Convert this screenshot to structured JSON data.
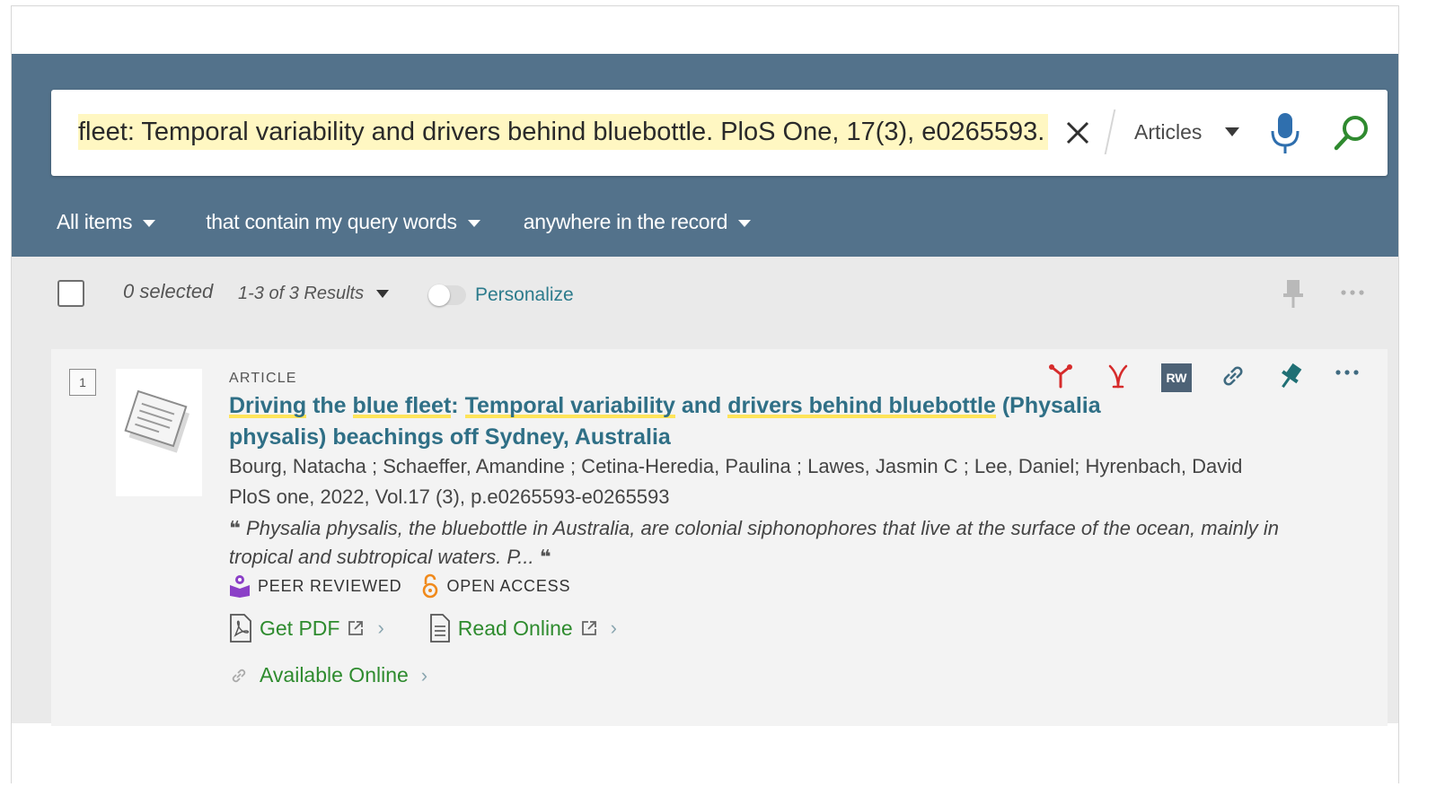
{
  "search": {
    "query_visible": "fleet: Temporal variability and drivers behind bluebottle. PloS One, 17(3), e0265593.",
    "scope": "Articles"
  },
  "filters": {
    "items": "All items",
    "match": "that contain my query words",
    "field": "anywhere in the record"
  },
  "results_bar": {
    "selected": "0 selected",
    "count": "1-3 of 3 Results",
    "personalize": "Personalize"
  },
  "result": {
    "index": "1",
    "type": "ARTICLE",
    "title_parts": [
      {
        "text": "Driving",
        "hl": true
      },
      {
        "text": " the ",
        "hl": false
      },
      {
        "text": "blue fleet",
        "hl": true
      },
      {
        "text": ": ",
        "hl": false
      },
      {
        "text": "Temporal variability",
        "hl": true
      },
      {
        "text": " and ",
        "hl": false
      },
      {
        "text": "drivers behind bluebottle",
        "hl": true
      },
      {
        "text": " (Physalia physalis) beachings off Sydney, Australia",
        "hl": false
      }
    ],
    "authors": "Bourg, Natacha ; Schaeffer, Amandine ; Cetina-Heredia, Paulina ; Lawes, Jasmin C ; Lee, Daniel; Hyrenbach, David",
    "source": "PloS one, 2022, Vol.17 (3), p.e0265593-e0265593",
    "snippet": "Physalia physalis, the bluebottle in Australia, are colonial siphonophores that live at the surface of the ocean, mainly in tropical and subtropical waters. P...",
    "badges": {
      "peer_reviewed": "PEER REVIEWED",
      "open_access": "OPEN ACCESS"
    },
    "links": {
      "get_pdf": "Get PDF",
      "read_online": "Read Online",
      "available_online": "Available Online"
    },
    "rw_label": "RW"
  },
  "colors": {
    "header": "#53728b",
    "highlight": "#ffe45a",
    "title": "#2f6f86",
    "link_green": "#2e8b2e",
    "peer_reviewed": "#8b3fc7",
    "open_access": "#f08a1c",
    "action_red": "#d62b2b",
    "pin_teal": "#1f6f74"
  },
  "icons": [
    "clear-icon",
    "mic-icon",
    "search-icon",
    "pin-icon",
    "more-icon",
    "cite-icon",
    "email-icon",
    "link-icon",
    "pdf-icon",
    "document-icon",
    "external-link-icon",
    "chevron-right-icon",
    "peer-reviewed-icon",
    "open-access-icon"
  ]
}
